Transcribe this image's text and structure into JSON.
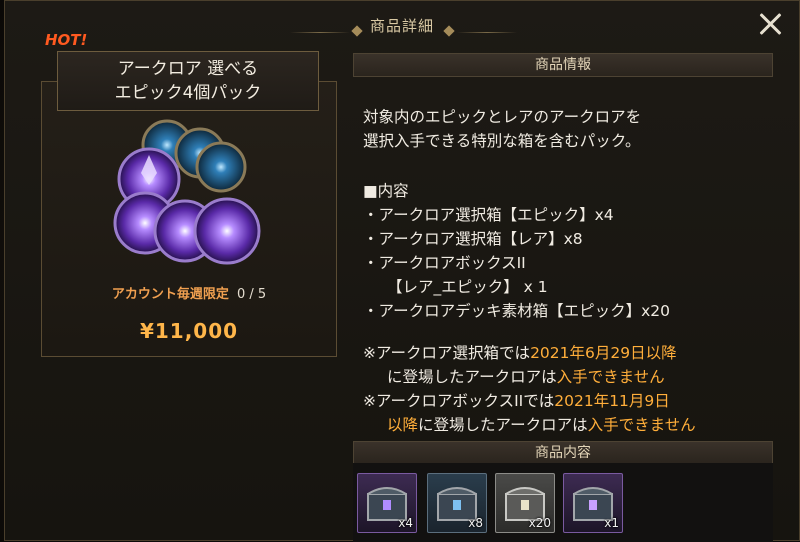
{
  "modal": {
    "title": "商品詳細"
  },
  "product": {
    "badge": "HOT!",
    "name_line1": "アークロア 選べる",
    "name_line2": "エピック4個パック",
    "limit_label": "アカウント毎週限定",
    "limit_count": "0 / 5",
    "price": "¥11,000"
  },
  "info": {
    "header": "商品情報",
    "desc_line1": "対象内のエピックとレアのアークロアを",
    "desc_line2": "選択入手できる特別な箱を含むパック。",
    "contents_title": "■内容",
    "contents": [
      "・アークロア選択箱【エピック】x4",
      "・アークロア選択箱【レア】x8",
      "・アークロアボックスII",
      "【レア_エピック】 x 1",
      "・アークロアデッキ素材箱【エピック】x20"
    ],
    "note1_prefix": "※アークロア選択箱では",
    "note1_date": "2021年6月29日以降",
    "note1_mid": "に登場したアークロアは",
    "note1_warn": "入手できません",
    "note2_prefix": "※アークロアボックスIIでは",
    "note2_date_a": "2021年11月9日",
    "note2_date_b": "以降",
    "note2_mid": "に登場したアークロアは",
    "note2_warn": "入手できません"
  },
  "items_section": {
    "header": "商品内容",
    "items": [
      {
        "icon": "epic-chest-icon",
        "qty": "x4"
      },
      {
        "icon": "rare-chest-icon",
        "qty": "x8"
      },
      {
        "icon": "material-chest-icon",
        "qty": "x20"
      },
      {
        "icon": "lore-box-icon",
        "qty": "x1"
      }
    ]
  },
  "colors": {
    "accent": "#ffae3a",
    "hot": "#ff5a20",
    "limit": "#f0a050"
  }
}
